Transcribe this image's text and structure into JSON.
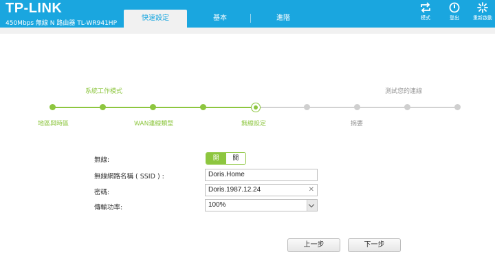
{
  "header": {
    "logo": "TP-LINK",
    "model": "450Mbps 無線 N 路由器 TL-WR941HP",
    "tabs": [
      {
        "label": "快速設定",
        "active": true
      },
      {
        "label": "基本",
        "active": false
      },
      {
        "label": "進階",
        "active": false
      }
    ],
    "buttons": [
      {
        "label": "模式",
        "icon": "mode-switch-icon"
      },
      {
        "label": "登出",
        "icon": "power-icon"
      },
      {
        "label": "重新啟動",
        "icon": "reboot-icon"
      }
    ]
  },
  "wizard": {
    "steps": [
      {
        "label": "地區與時區",
        "state": "done"
      },
      {
        "label": "系統工作模式",
        "state": "done"
      },
      {
        "label": "WAN連線類型",
        "state": "done"
      },
      {
        "label": "",
        "state": "done"
      },
      {
        "label": "無線設定",
        "state": "current"
      },
      {
        "label": "",
        "state": "todo"
      },
      {
        "label": "摘要",
        "state": "todo"
      },
      {
        "label": "",
        "state": "todo"
      },
      {
        "label": "測試您的連線",
        "state": "todo"
      }
    ]
  },
  "form": {
    "wireless": {
      "label": "無線:",
      "on_label": "開",
      "off_label": "關",
      "value": "on"
    },
    "ssid": {
      "label": "無線網路名稱 ( SSID ) :",
      "value": "Doris.Home"
    },
    "password": {
      "label": "密碼:",
      "value": "Doris.1987.12.24"
    },
    "tx_power": {
      "label": "傳輸功率:",
      "value": "100%"
    }
  },
  "footer": {
    "back_label": "上一步",
    "next_label": "下一步"
  },
  "colors": {
    "header": "#1aa6df",
    "accent": "#8dc63f",
    "inactive": "#cfcfcf"
  }
}
